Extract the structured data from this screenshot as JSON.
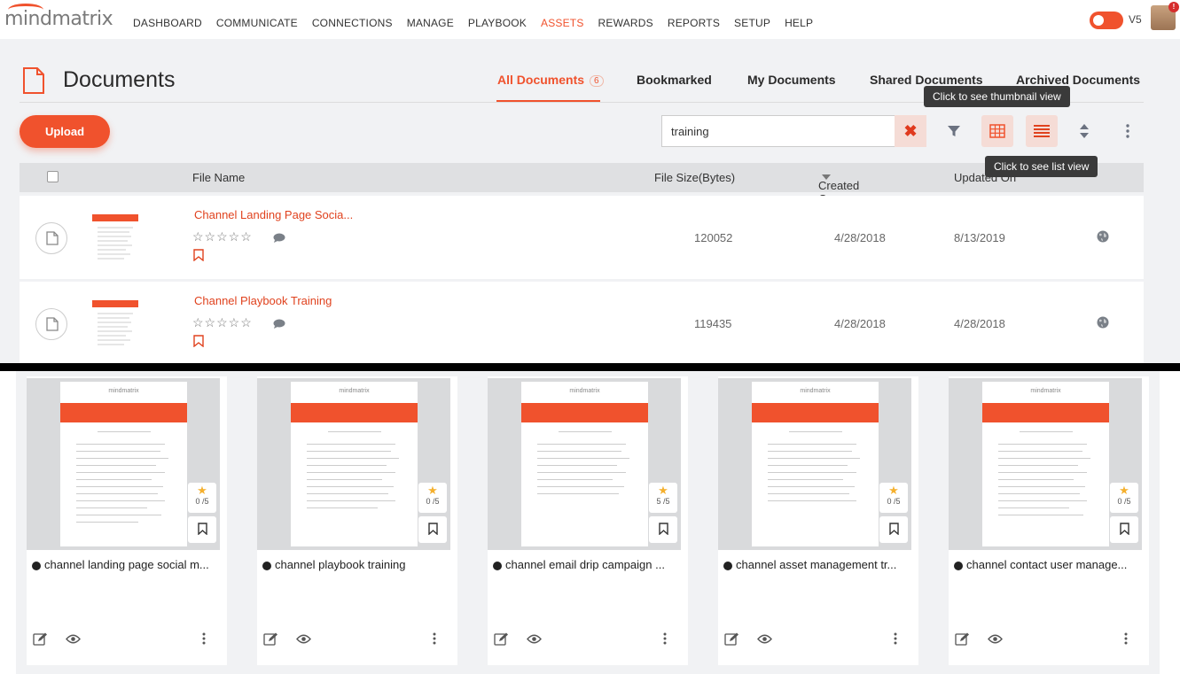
{
  "app": {
    "logo": "mindmatrix",
    "version_label": "V5",
    "notification_badge": "!"
  },
  "nav": {
    "items": [
      "DASHBOARD",
      "COMMUNICATE",
      "CONNECTIONS",
      "MANAGE",
      "PLAYBOOK",
      "ASSETS",
      "REWARDS",
      "REPORTS",
      "SETUP",
      "HELP"
    ],
    "active": "ASSETS"
  },
  "page": {
    "title": "Documents"
  },
  "tabs": [
    {
      "label": "All Documents",
      "count": "6",
      "active": true
    },
    {
      "label": "Bookmarked"
    },
    {
      "label": "My Documents"
    },
    {
      "label": "Shared Documents"
    },
    {
      "label": "Archived Documents"
    }
  ],
  "toolbar": {
    "upload_label": "Upload",
    "search_value": "training",
    "thumbnail_tooltip": "Click to see thumbnail view",
    "list_tooltip": "Click to see list view"
  },
  "table": {
    "headers": {
      "file_name": "File Name",
      "file_size": "File Size(Bytes)",
      "created_on": "Created On",
      "updated_on": "Updated On"
    },
    "rows": [
      {
        "name": "Channel Landing Page Socia...",
        "size": "120052",
        "created": "4/28/2018",
        "updated": "8/13/2019"
      },
      {
        "name": "Channel Playbook Training",
        "size": "119435",
        "created": "4/28/2018",
        "updated": "4/28/2018"
      }
    ]
  },
  "cards": [
    {
      "title": "channel landing page social m...",
      "rating": "0 /5",
      "doc_logo": "mindmatrix"
    },
    {
      "title": "channel playbook training",
      "rating": "0 /5",
      "doc_logo": "mindmatrix"
    },
    {
      "title": "channel email drip campaign ...",
      "rating": "5 /5",
      "doc_logo": "mindmatrix"
    },
    {
      "title": "channel asset management tr...",
      "rating": "0 /5",
      "doc_logo": "mindmatrix"
    },
    {
      "title": "channel contact user manage...",
      "rating": "0 /5",
      "doc_logo": "mindmatrix"
    }
  ],
  "colors": {
    "accent": "#f0522d",
    "panel_bg": "#f1f2f4",
    "header_bg": "#dfe0e2",
    "star": "#f5b02e"
  }
}
